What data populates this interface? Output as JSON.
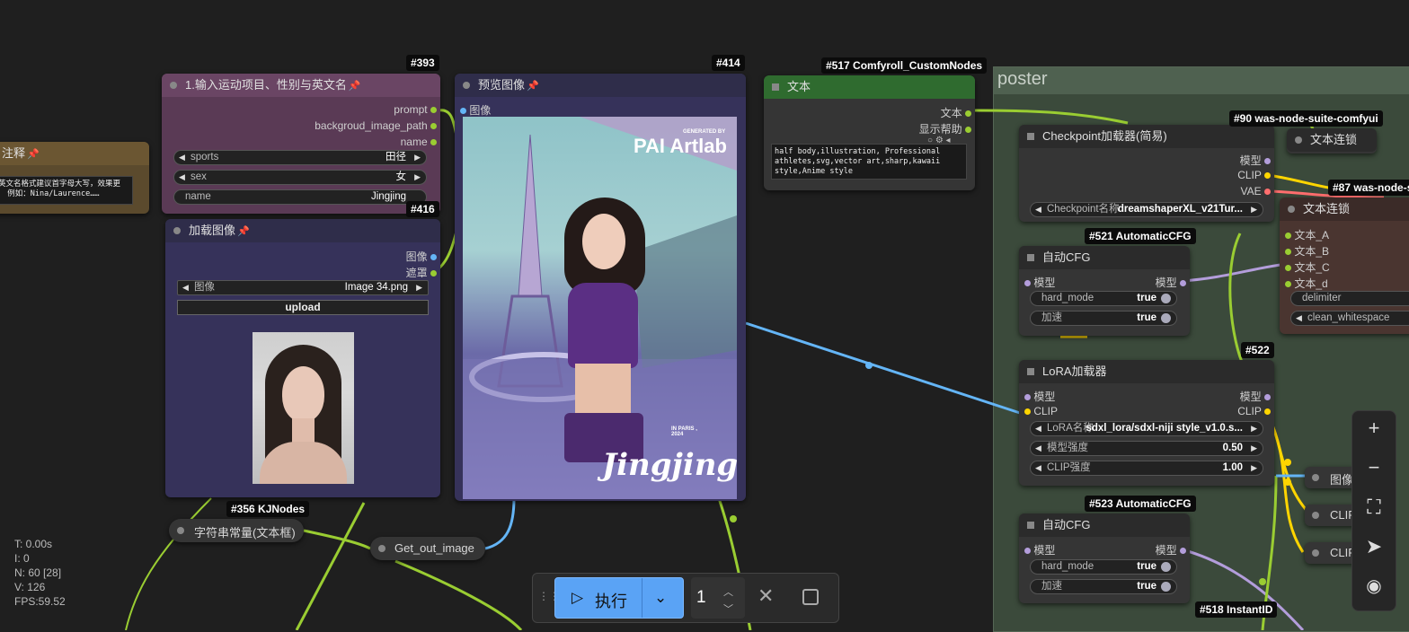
{
  "group": {
    "title": "poster"
  },
  "comment_node": {
    "title": "注释",
    "text": "英文名格式建议首字母大写，效果更\n  例如：Nina/Laurence……"
  },
  "node_393": {
    "badge": "#393",
    "title": "1.输入运动项目、性别与英文名",
    "outputs": [
      "prompt",
      "backgroud_image_path",
      "name"
    ],
    "widgets": [
      {
        "label": "sports",
        "value": "田径"
      },
      {
        "label": "sex",
        "value": "女"
      },
      {
        "label": "name",
        "value": "Jingjing"
      }
    ]
  },
  "node_416": {
    "badge": "#416",
    "title": "加载图像",
    "outputs": [
      "图像",
      "遮罩"
    ],
    "image_widget": {
      "label": "图像",
      "value": "Image 34.png"
    },
    "upload_label": "upload"
  },
  "node_414": {
    "badge": "#414",
    "title": "预览图像",
    "input": "图像",
    "poster": {
      "tag": "GENERATED BY",
      "brand": "PAI Artlab",
      "city": "IN PARIS ,\n2024",
      "name": "Jingjing"
    }
  },
  "node_517": {
    "badge": "#517 Comfyroll_CustomNodes",
    "title": "文本",
    "outputs": [
      "文本",
      "显示帮助"
    ],
    "text": "half body,illustration, Professional athletes,svg,vector art,sharp,kawaii style,Anime style"
  },
  "node_checkpoint": {
    "title": "Checkpoint加载器(简易)",
    "outputs": [
      "模型",
      "CLIP",
      "VAE"
    ],
    "widget": {
      "label": "Checkpoint名称",
      "value": "dreamshaperXL_v21Tur..."
    }
  },
  "node_90": {
    "badge": "#90 was-node-suite-comfyui",
    "title": "文本连锁"
  },
  "node_87": {
    "badge": "#87 was-node-s",
    "title": "文本连锁",
    "inputs": [
      "文本_A",
      "文本_B",
      "文本_C",
      "文本_d"
    ],
    "widgets": [
      {
        "label": "delimiter",
        "value": ""
      },
      {
        "label": "clean_whitespace",
        "value": ""
      }
    ]
  },
  "node_521": {
    "badge": "#521 AutomaticCFG",
    "title": "自动CFG",
    "input": "模型",
    "output": "模型",
    "widgets": [
      {
        "label": "hard_mode",
        "value": "true"
      },
      {
        "label": "加速",
        "value": "true"
      }
    ]
  },
  "node_522": {
    "badge": "#522",
    "title": "LoRA加载器",
    "inputs": [
      "模型",
      "CLIP"
    ],
    "outputs": [
      "模型",
      "CLIP"
    ],
    "widgets": [
      {
        "label": "LoRA名称",
        "value": "sdxl_lora/sdxl-niji style_v1.0.s..."
      },
      {
        "label": "模型强度",
        "value": "0.50"
      },
      {
        "label": "CLIP强度",
        "value": "1.00"
      }
    ]
  },
  "node_523": {
    "badge": "#523 AutomaticCFG",
    "title": "自动CFG",
    "input": "模型",
    "output": "模型",
    "widgets": [
      {
        "label": "hard_mode",
        "value": "true"
      },
      {
        "label": "加速",
        "value": "true"
      }
    ]
  },
  "node_518": {
    "badge": "#518 InstantID"
  },
  "partial_nodes": [
    "图像",
    "CLIP",
    "CLIP"
  ],
  "node_356": {
    "badge": "#356 KJNodes",
    "title": "字符串常量(文本框)"
  },
  "get_node": {
    "title": "Get_out_image"
  },
  "stats": {
    "t": "T: 0.00s",
    "i": "I: 0",
    "n": "N: 60 [28]",
    "v": "V: 126",
    "fps": "FPS:59.52"
  },
  "toolbar": {
    "run_label": "执行",
    "count": "1"
  },
  "colors": {
    "model": "#b39ddb",
    "clip": "#ffd500",
    "vae": "#ff6e6e",
    "image": "#64b5f6",
    "string": "#9acd32",
    "accent": "#5aa3f5"
  }
}
